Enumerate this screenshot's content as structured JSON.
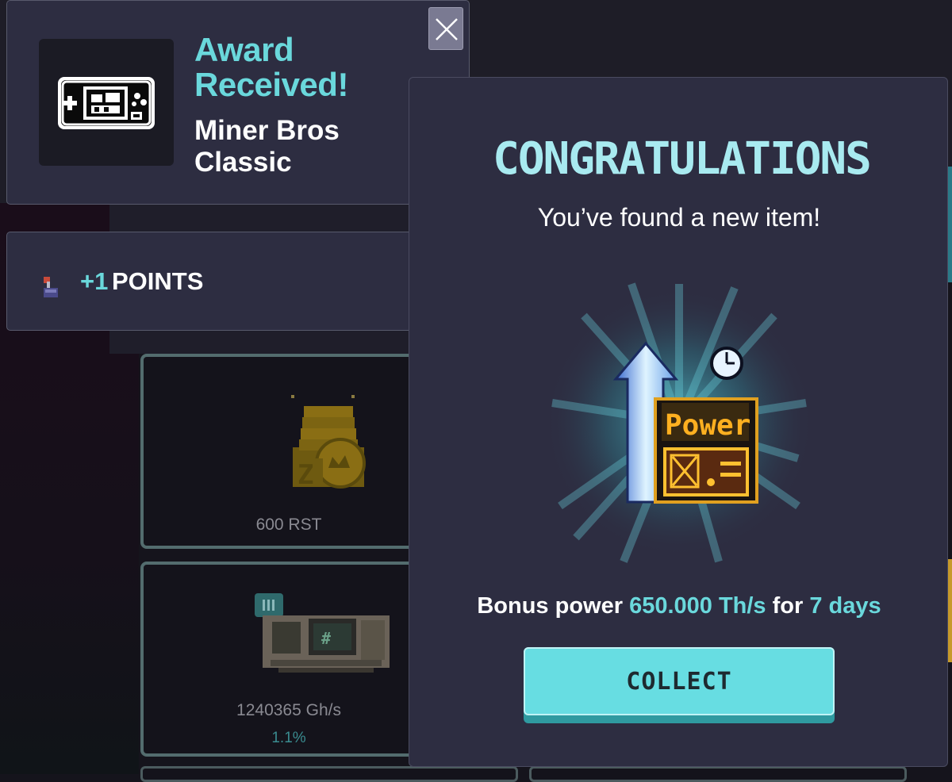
{
  "award_toast": {
    "title": "Award Received!",
    "item_name": "Miner Bros Classic",
    "close_icon": "close-icon"
  },
  "points_toast": {
    "amount": "+1",
    "label": "POINTS",
    "icon": "joystick-icon",
    "close_icon": "close-icon"
  },
  "modal": {
    "title": "CONGRATULATIONS",
    "subtitle": "You’ve found a new item!",
    "item_art_text": "Power",
    "bonus_prefix": "Bonus power",
    "bonus_value": "650.000 Th/s",
    "bonus_for": "for",
    "bonus_duration": "7 days",
    "collect_label": "COLLECT"
  },
  "background_cards": [
    {
      "caption": "600 RST"
    },
    {
      "caption": "1240365 Gh/s",
      "percent": "1.1%",
      "badge": "III"
    }
  ],
  "colors": {
    "accent_cyan": "#6ad8dc",
    "panel": "#2d2d41",
    "title_cyan": "#a8eaf0",
    "button": "#67dde2"
  }
}
